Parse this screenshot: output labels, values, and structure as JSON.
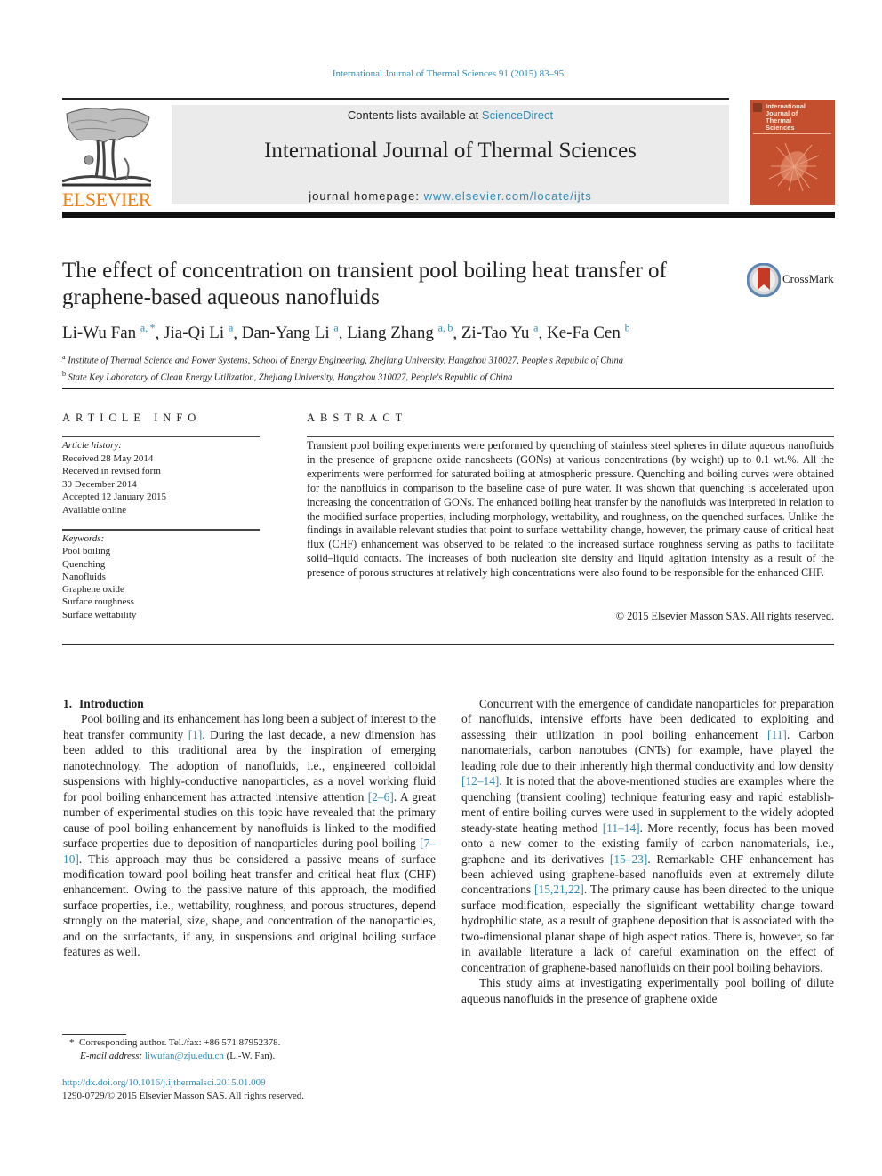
{
  "running_header": "International Journal of Thermal Sciences 91 (2015) 83–95",
  "masthead": {
    "publisher_logo_text": "ELSEVIER",
    "contents_prefix": "Contents lists available at ",
    "contents_link": "ScienceDirect",
    "journal_title": "International Journal of Thermal Sciences",
    "homepage_prefix": "journal homepage: ",
    "homepage_link": "www.elsevier.com/locate/ijts",
    "cover_title": "International\nJournal of\nThermal\nSciences",
    "brand_orange": "#f07f13",
    "link_color": "#2e8bb8",
    "cover_color": "#c44f2e"
  },
  "article": {
    "title": "The effect of concentration on transient pool boiling heat transfer of graphene-based aqueous nanofluids",
    "crossmark_label": "CrossMark",
    "authors": [
      {
        "name": "Li-Wu Fan",
        "sup": "a, *",
        "sep": ", "
      },
      {
        "name": "Jia-Qi Li",
        "sup": "a",
        "sep": ", "
      },
      {
        "name": "Dan-Yang Li",
        "sup": "a",
        "sep": ", "
      },
      {
        "name": "Liang Zhang",
        "sup": "a, b",
        "sep": ", "
      },
      {
        "name": "Zi-Tao Yu",
        "sup": "a",
        "sep": ", "
      },
      {
        "name": "Ke-Fa Cen",
        "sup": "b",
        "sep": ""
      }
    ],
    "affiliations": [
      {
        "mark": "a",
        "text": "Institute of Thermal Science and Power Systems, School of Energy Engineering, Zhejiang University, Hangzhou 310027, People's Republic of China"
      },
      {
        "mark": "b",
        "text": "State Key Laboratory of Clean Energy Utilization, Zhejiang University, Hangzhou 310027, People's Republic of China"
      }
    ]
  },
  "article_info": {
    "heading": "ARTICLE INFO",
    "history_label": "Article history:",
    "history": [
      "Received 28 May 2014",
      "Received in revised form",
      "30 December 2014",
      "Accepted 12 January 2015",
      "Available online"
    ],
    "keywords_label": "Keywords:",
    "keywords": [
      "Pool boiling",
      "Quenching",
      "Nanofluids",
      "Graphene oxide",
      "Surface roughness",
      "Surface wettability"
    ]
  },
  "abstract": {
    "heading": "ABSTRACT",
    "text": "Transient pool boiling experiments were performed by quenching of stainless steel spheres in dilute aqueous nanofluids in the presence of graphene oxide nanosheets (GONs) at various concentrations (by weight) up to 0.1 wt.%. All the experiments were performed for saturated boiling at atmospheric pres­sure. Quenching and boiling curves were obtained for the nanofluids in comparison to the baseline case of pure water. It was shown that quenching is accelerated upon increasing the concentration of GONs. The enhanced boiling heat transfer by the nanofluids was interpreted in relation to the modified surface properties, including morphology, wettability, and roughness, on the quenched surfaces. Unlike the findings in available relevant studies that point to surface wettability change, however, the primary cause of critical heat flux (CHF) enhancement was observed to be related to the increased surface roughness serving as paths to facilitate solid–liquid contacts. The increases of both nucleation site density and liquid agitation intensity as a result of the presence of porous structures at relatively high concentrations were also found to be responsible for the enhanced CHF.",
    "copyright": "© 2015 Elsevier Masson SAS. All rights reserved."
  },
  "body": {
    "section_number": "1.",
    "section_title": "Introduction",
    "left_paragraph": [
      {
        "t": "Pool boiling and its enhancement has long been a subject of interest to the heat transfer community "
      },
      {
        "ref": "[1]"
      },
      {
        "t": ". During the last decade, a new dimension has been added to this traditional area by the inspiration of emerging nanotechnology. The adoption of nano­fluids, i.e., engineered colloidal suspensions with highly-conductive nanoparticles, as a novel working fluid for pool boiling enhance­ment has attracted intensive attention "
      },
      {
        "ref": "[2–6]"
      },
      {
        "t": ". A great number of experimental studies on this topic have revealed that the primary cause of pool boiling enhancement by nanofluids is linked to the modified surface properties due to deposition of nanoparticles during pool boiling "
      },
      {
        "ref": "[7–10]"
      },
      {
        "t": ". This approach may thus be considered a passive means of surface modification toward pool boiling heat transfer and critical heat flux (CHF) enhancement. Owing to the passive nature of this approach, the modified surface properties, i.e., wettability, roughness, and porous structures, depend strongly on the material, size, shape, and concentration of the nanoparticles, and on the surfactants, if any, in suspensions and original boiling surface features as well."
      }
    ],
    "right_paragraph_1": [
      {
        "t": "Concurrent with the emergence of candidate nanoparticles for preparation of nanofluids, intensive efforts have been dedicated to exploiting and assessing their utilization in pool boiling enhance­ment "
      },
      {
        "ref": "[11]"
      },
      {
        "t": ". Carbon nanomaterials, carbon nanotubes (CNTs) for example, have played the leading role due to their inherently high thermal conductivity and low density "
      },
      {
        "ref": "[12–14]"
      },
      {
        "t": ". It is noted that the above-mentioned studies are examples where the quenching (transient cooling) technique featuring easy and rapid establish­ment of entire boiling curves were used in supplement to the widely adopted steady-state heating method "
      },
      {
        "ref": "[11–14]"
      },
      {
        "t": ". More recently, focus has been moved onto a new comer to the existing family of carbon nanomaterials, i.e., graphene and its derivatives "
      },
      {
        "ref": "[15–23]"
      },
      {
        "t": ". Remarkable CHF enhancement has been achieved using graphene-based nanofluids even at extremely dilute concentra­tions "
      },
      {
        "ref": "[15,21,22]"
      },
      {
        "t": ". The primary cause has been directed to the unique surface modification, especially the significant wettability change toward hydrophilic state, as a result of graphene deposition that is associated with the two-dimensional planar shape of high aspect ratios. There is, however, so far in available literature a lack of careful examination on the effect of concentration of graphene-based nanofluids on their pool boiling behaviors."
      }
    ],
    "right_paragraph_2": [
      {
        "t": "This study aims at investigating experimentally pool boiling of dilute aqueous nanofluids in the presence of graphene oxide"
      }
    ]
  },
  "footnotes": {
    "corresponding": "* Corresponding author. Tel./fax: +86 571 87952378.",
    "email_label": "E-mail address: ",
    "email": "liwufan@zju.edu.cn",
    "email_suffix": " (L.-W. Fan).",
    "doi": "http://dx.doi.org/10.1016/j.ijthermalsci.2015.01.009",
    "issn_copyright": "1290-0729/© 2015 Elsevier Masson SAS. All rights reserved."
  }
}
